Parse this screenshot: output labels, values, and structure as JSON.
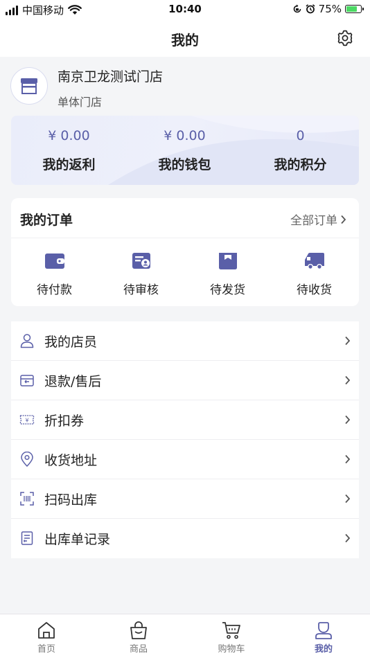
{
  "status_bar": {
    "carrier": "中国移动",
    "time": "10:40",
    "battery": "75%",
    "battery_level": 0.75
  },
  "nav": {
    "title": "我的"
  },
  "store": {
    "name": "南京卫龙测试门店",
    "type": "单体门店"
  },
  "stats": [
    {
      "value": "¥ 0.00",
      "label": "我的返利"
    },
    {
      "value": "¥ 0.00",
      "label": "我的钱包"
    },
    {
      "value": "0",
      "label": "我的积分"
    }
  ],
  "orders": {
    "title": "我的订单",
    "all_label": "全部订单",
    "items": [
      {
        "label": "待付款",
        "icon": "wallet-icon"
      },
      {
        "label": "待审核",
        "icon": "review-card-icon"
      },
      {
        "label": "待发货",
        "icon": "package-box-icon"
      },
      {
        "label": "待收货",
        "icon": "delivery-truck-icon"
      }
    ]
  },
  "menu": [
    {
      "label": "我的店员",
      "icon": "person-icon"
    },
    {
      "label": "退款/售后",
      "icon": "return-box-icon"
    },
    {
      "label": "折扣券",
      "icon": "coupon-icon"
    },
    {
      "label": "收货地址",
      "icon": "location-pin-icon"
    },
    {
      "label": "扫码出库",
      "icon": "scan-icon"
    },
    {
      "label": "出库单记录",
      "icon": "record-list-icon"
    }
  ],
  "tabs": [
    {
      "label": "首页",
      "icon": "home-icon"
    },
    {
      "label": "商品",
      "icon": "shopping-bag-icon"
    },
    {
      "label": "购物车",
      "icon": "cart-icon"
    },
    {
      "label": "我的",
      "icon": "user-profile-icon",
      "active": true
    }
  ],
  "colors": {
    "accent": "#5a5fa8",
    "icon_fill": "#5a5fa8",
    "background": "#f4f5f7"
  }
}
